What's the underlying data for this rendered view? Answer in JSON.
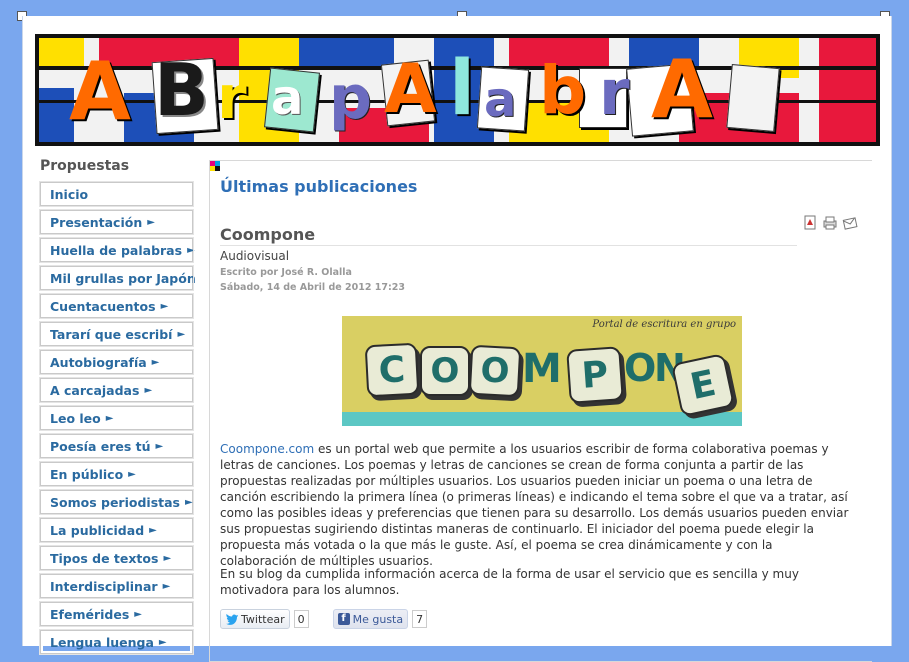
{
  "banner": {
    "letters": [
      "A",
      "B",
      "r",
      "a",
      "p",
      "A",
      "l",
      "a",
      "b",
      "r",
      "A"
    ]
  },
  "sidebar": {
    "title": "Propuestas",
    "items": [
      {
        "label": "Inicio",
        "arrow": ""
      },
      {
        "label": "Presentación",
        "arrow": "►"
      },
      {
        "label": "Huella de palabras",
        "arrow": "►"
      },
      {
        "label": "Mil grullas por Japón",
        "arrow": ""
      },
      {
        "label": "Cuentacuentos",
        "arrow": "►"
      },
      {
        "label": "Tararí que escribí",
        "arrow": "►"
      },
      {
        "label": "Autobiografía",
        "arrow": "►"
      },
      {
        "label": "A carcajadas",
        "arrow": "►"
      },
      {
        "label": "Leo leo",
        "arrow": "►"
      },
      {
        "label": "Poesía eres tú",
        "arrow": "►"
      },
      {
        "label": "En público",
        "arrow": "►"
      },
      {
        "label": "Somos periodistas",
        "arrow": "►"
      },
      {
        "label": "La publicidad",
        "arrow": "►"
      },
      {
        "label": "Tipos de textos",
        "arrow": "►"
      },
      {
        "label": "Interdisciplinar",
        "arrow": "►"
      },
      {
        "label": "Efemérides",
        "arrow": "►"
      },
      {
        "label": "Lengua luenga",
        "arrow": "►"
      }
    ]
  },
  "main": {
    "section_title": "Últimas publicaciones",
    "article": {
      "title": "Coompone",
      "category": "Audiovisual",
      "author": "Escrito por José R. Olalla",
      "date": "Sábado, 14 de Abril de 2012 17:23",
      "image": {
        "tagline": "Portal de escritura en grupo",
        "letters": [
          "C",
          "O",
          "O",
          "M",
          "P",
          "O",
          "N",
          "E"
        ]
      },
      "p1_link": "Coompone.com",
      "p1_rest": " es un portal web que permite a los usuarios escribir de forma colaborativa poemas y letras de canciones. Los poemas y letras de canciones se crean de forma conjunta a partir de las propuestas realizadas por múltiples usuarios. Los usuarios pueden iniciar un poema o una letra de canción escribiendo la primera línea (o primeras líneas) e indicando el tema sobre el que va a tratar, así como las posibles ideas y preferencias que tienen para su desarrollo. Los demás usuarios pueden enviar sus propuestas sugiriendo distintas maneras de continuarlo. El iniciador del poema puede elegir la propuesta más votada o la que más le guste. Así, el poema se crea dinámicamente y con la colaboración de múltiples usuarios.",
      "p2": "En su blog da cumplida información acerca de la forma de usar el servicio que es sencilla y muy motivadora para los alumnos."
    },
    "social": {
      "tweet_label": "Twittear",
      "tweet_count": "0",
      "like_label": "Me gusta",
      "like_count": "7"
    }
  },
  "colors": {
    "link": "#2f6fb6",
    "nav_text": "#2a6aa0",
    "page_bg": "#7aa7ee"
  }
}
